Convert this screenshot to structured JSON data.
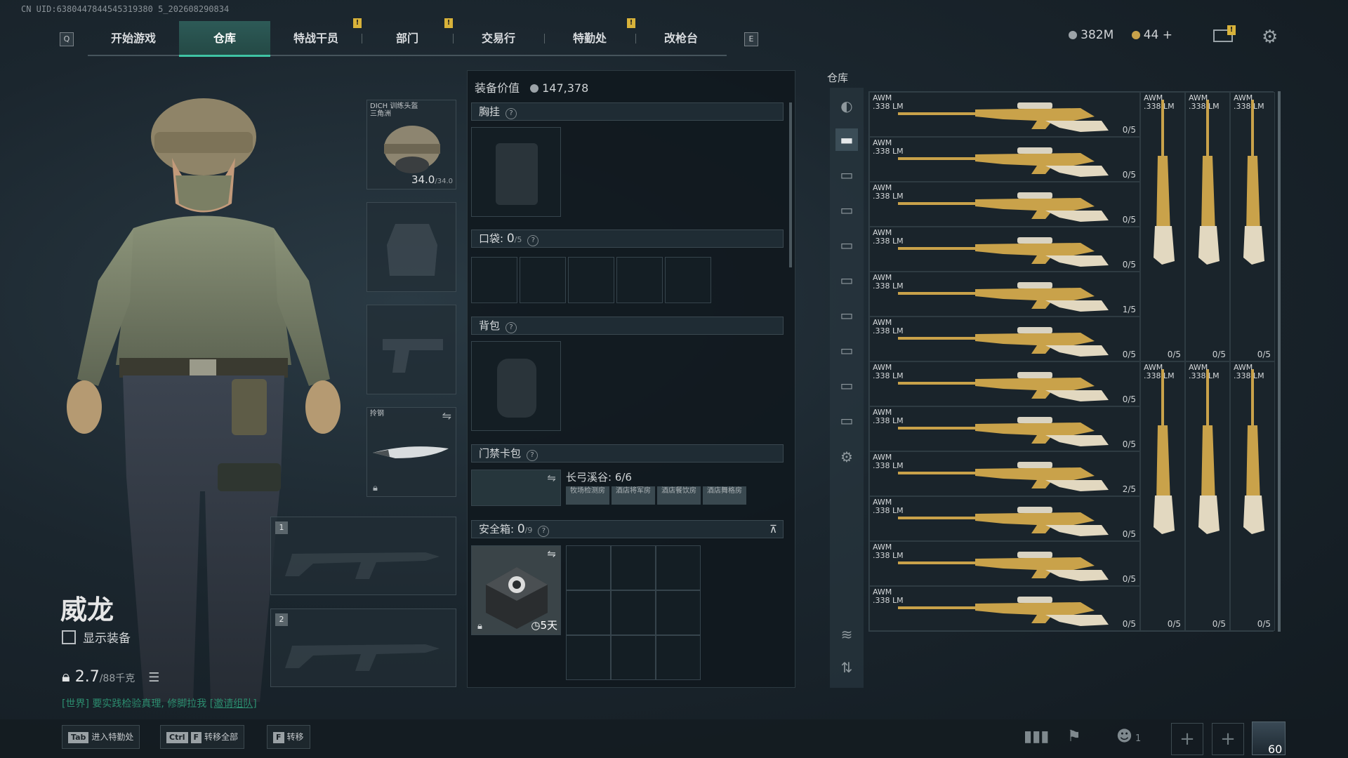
{
  "uid_text": "CN UID:6380447844545319380 5_202608290834",
  "nav": {
    "left_key": "Q",
    "right_key": "E",
    "tabs": [
      {
        "label": "开始游戏",
        "alert": false
      },
      {
        "label": "仓库",
        "alert": false
      },
      {
        "label": "特战干员",
        "alert": true
      },
      {
        "label": "部门",
        "alert": true
      },
      {
        "label": "交易行",
        "alert": false
      },
      {
        "label": "特勤处",
        "alert": true
      },
      {
        "label": "改枪台",
        "alert": false
      }
    ],
    "active_tab": "仓库",
    "alert_glyph": "!"
  },
  "currency": {
    "silver": "382M",
    "gold": "44",
    "add": "+"
  },
  "character": {
    "name": "威龙",
    "show_equipment": "显示装备",
    "weight": "2.7",
    "weight_max": "/88千克"
  },
  "chat": {
    "channel": "[世界]",
    "message": "要实践检验真理, 修脚拉我",
    "link": "[邀请组队]"
  },
  "slots": {
    "helmet_name": "DICH 训练头盔",
    "helmet_sub": "三角洲",
    "helmet_durability": "34.0",
    "helmet_durability_max": "/34.0",
    "melee_label": "拎钢",
    "weapon1": "1",
    "weapon2": "2"
  },
  "equipment": {
    "value_label": "装备价值",
    "value": "147,378",
    "chest_rig": "胸挂",
    "pockets": "口袋:",
    "pockets_count": "0",
    "pockets_max": "/5",
    "backpack": "背包",
    "keycard": "门禁卡包",
    "keycard_map": "长弓溪谷: 6/6",
    "keycard_items": [
      "牧场检测房",
      "酒店将军房",
      "酒店餐饮房",
      "酒店舞格房"
    ],
    "safebox": "安全箱:",
    "safebox_count": "0",
    "safebox_max": "/9",
    "safebox_timer": "5天"
  },
  "warehouse": {
    "title": "仓库",
    "item_name": "AWM",
    "item_ammo": ".338 LM",
    "rows_horizontal": [
      {
        "count": "0/5"
      },
      {
        "count": "0/5"
      },
      {
        "count": "0/5"
      },
      {
        "count": "0/5"
      },
      {
        "count": "1/5"
      },
      {
        "count": "0/5"
      },
      {
        "count": "0/5"
      },
      {
        "count": "0/5"
      },
      {
        "count": "2/5"
      },
      {
        "count": "0/5"
      },
      {
        "count": "0/5"
      },
      {
        "count": "0/5"
      }
    ],
    "vertical_counts_top": [
      "0/5",
      "0/5",
      "0/5"
    ],
    "vertical_counts_bottom": [
      "0/5",
      "0/5",
      "0/5"
    ]
  },
  "bottombar": {
    "tab_key": "Tab",
    "tab_label": "进入特勤处",
    "ctrl_key": "Ctrl",
    "f_key": "F",
    "transfer_all": "转移全部",
    "transfer": "转移",
    "friends_count": "1",
    "level": "60"
  },
  "colors": {
    "accent": "#3fc4a4",
    "alert": "#d8b23a",
    "chat_green": "#2c8d6f",
    "gold_weapon": "#c9a24a"
  }
}
